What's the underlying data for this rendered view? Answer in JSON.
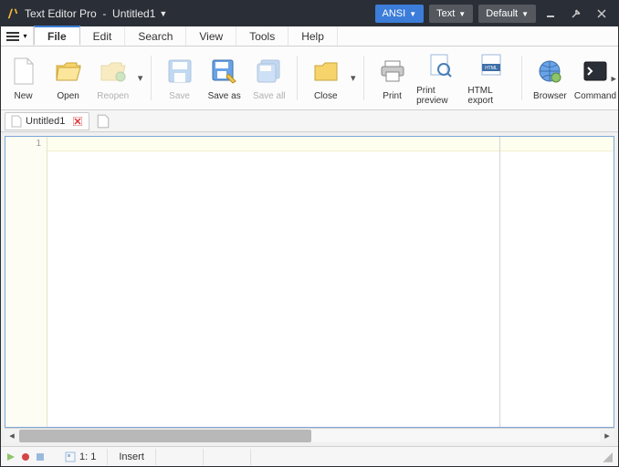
{
  "titlebar": {
    "app_name": "Text Editor Pro",
    "doc_name": "Untitled1",
    "encoding_label": "ANSI",
    "mode_label": "Text",
    "theme_label": "Default"
  },
  "menus": {
    "file": "File",
    "edit": "Edit",
    "search": "Search",
    "view": "View",
    "tools": "Tools",
    "help": "Help"
  },
  "ribbon": {
    "new": "New",
    "open": "Open",
    "reopen": "Reopen",
    "save": "Save",
    "saveas": "Save as",
    "saveall": "Save all",
    "close": "Close",
    "print": "Print",
    "printpreview": "Print preview",
    "htmlexport": "HTML export",
    "browser": "Browser",
    "command": "Command"
  },
  "doctab": {
    "name": "Untitled1"
  },
  "editor": {
    "line1_number": "1"
  },
  "status": {
    "position": "1: 1",
    "mode": "Insert"
  }
}
